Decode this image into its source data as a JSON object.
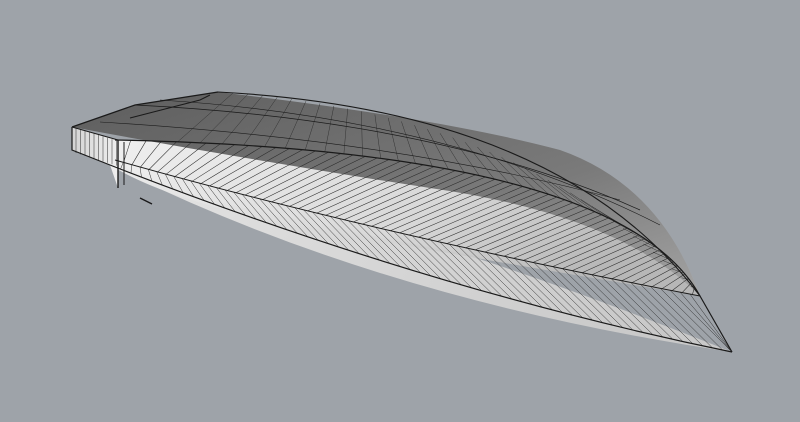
{
  "viewport": {
    "background": "#9ea3a9",
    "projection": "perspective",
    "display_mode": "shaded-with-isocurves"
  },
  "model": {
    "object_type": "boat-hull",
    "surfaces": [
      "transom",
      "deck",
      "topside-port",
      "bottom-port"
    ],
    "colors": {
      "deck_top": "#6e6e6e",
      "deck_bottom": "#9c9c9c",
      "side_light": "#ececec",
      "side_dark": "#b9b9b9",
      "bottom_light": "#e8e8e8",
      "bottom_dark": "#c6c6c6",
      "transom": "#dcdcdc",
      "edge": "#1a1a1a",
      "isocurve": "#2b2b2b"
    }
  }
}
